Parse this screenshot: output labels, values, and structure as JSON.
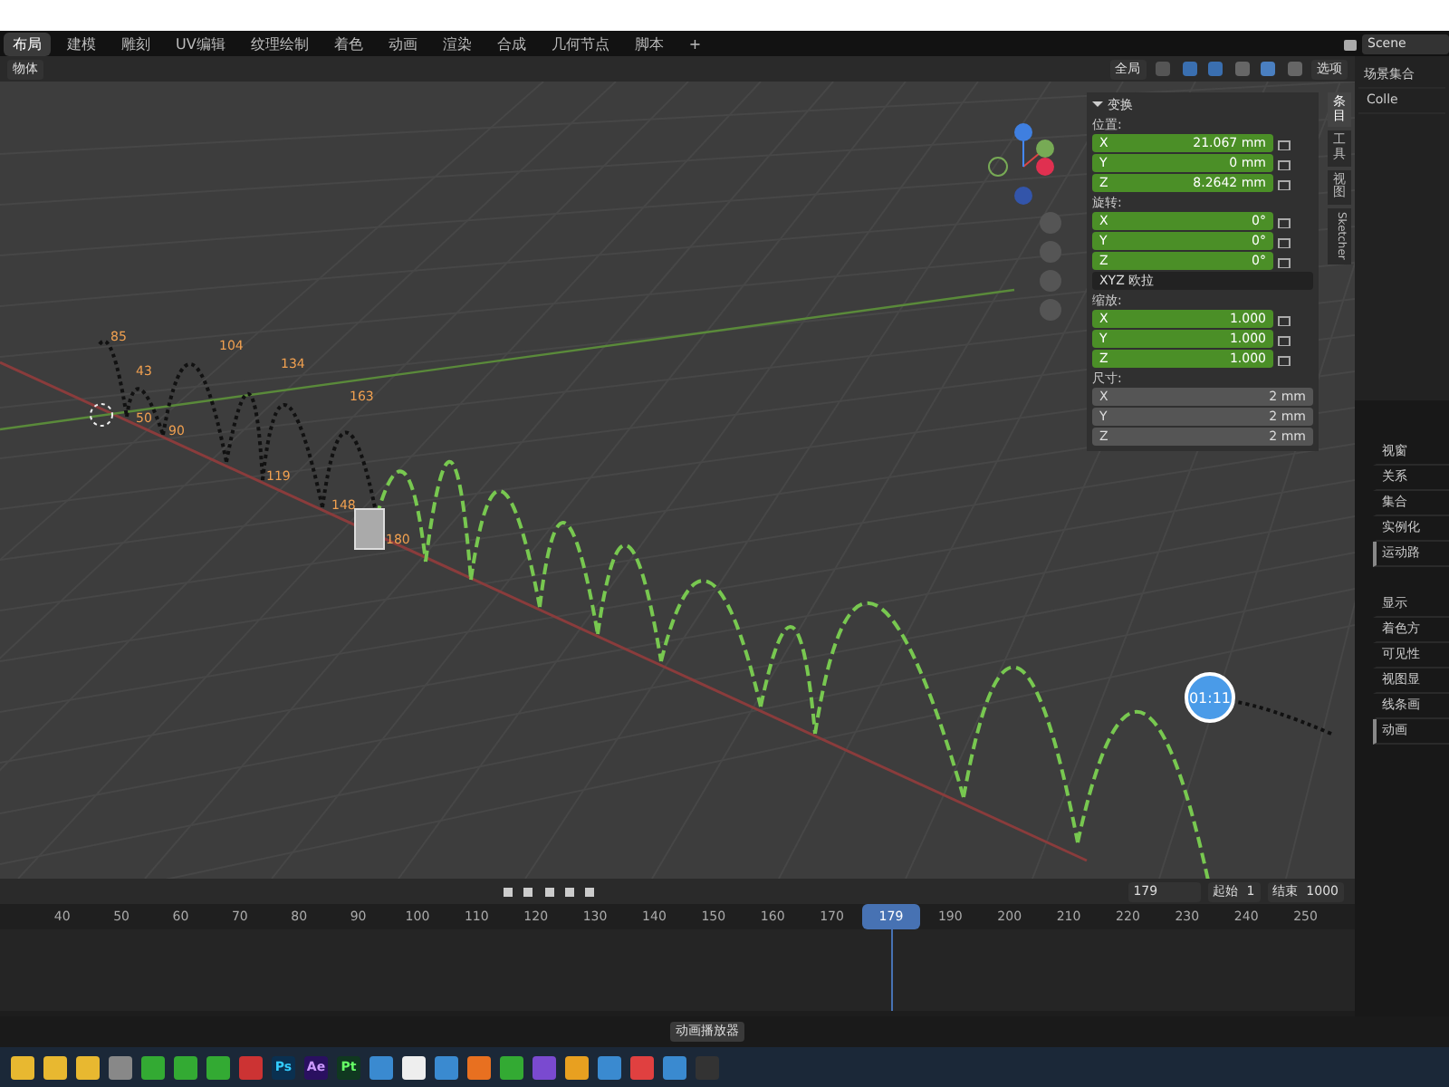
{
  "workspace_tabs": [
    {
      "label": "布局",
      "selected": true
    },
    {
      "label": "建模",
      "selected": false
    },
    {
      "label": "雕刻",
      "selected": false
    },
    {
      "label": "UV编辑",
      "selected": false
    },
    {
      "label": "纹理绘制",
      "selected": false
    },
    {
      "label": "着色",
      "selected": false
    },
    {
      "label": "动画",
      "selected": false
    },
    {
      "label": "渲染",
      "selected": false
    },
    {
      "label": "合成",
      "selected": false
    },
    {
      "label": "几何节点",
      "selected": false
    },
    {
      "label": "脚本",
      "selected": false
    }
  ],
  "add_workspace": "+",
  "scene": {
    "name": "Scene"
  },
  "header": {
    "mode": "物体",
    "orientation": "全局",
    "options": "选项"
  },
  "viewport": {
    "path_labels": [
      "85",
      "43",
      "50",
      "90",
      "104",
      "134",
      "163",
      "119",
      "148",
      "180"
    ],
    "timer": "01:11"
  },
  "sidebar_tabs": [
    {
      "label": "条目",
      "selected": true
    },
    {
      "label": "工具",
      "selected": false
    },
    {
      "label": "视图",
      "selected": false
    },
    {
      "label": "Sketcher",
      "selected": false
    }
  ],
  "transform": {
    "title": "变换",
    "expanded": true,
    "groups": [
      {
        "label": "位置:",
        "animated": true,
        "fields": [
          {
            "axis": "X",
            "value": "21.067 mm"
          },
          {
            "axis": "Y",
            "value": "0 mm"
          },
          {
            "axis": "Z",
            "value": "8.2642 mm"
          }
        ]
      },
      {
        "label": "旋转:",
        "animated": true,
        "fields": [
          {
            "axis": "X",
            "value": "0°"
          },
          {
            "axis": "Y",
            "value": "0°"
          },
          {
            "axis": "Z",
            "value": "0°"
          }
        ]
      },
      {
        "label": "缩放:",
        "animated": true,
        "fields": [
          {
            "axis": "X",
            "value": "1.000"
          },
          {
            "axis": "Y",
            "value": "1.000"
          },
          {
            "axis": "Z",
            "value": "1.000"
          }
        ]
      },
      {
        "label": "尺寸:",
        "animated": false,
        "fields": [
          {
            "axis": "X",
            "value": "2 mm"
          },
          {
            "axis": "Y",
            "value": "2 mm"
          },
          {
            "axis": "Z",
            "value": "2 mm"
          }
        ]
      }
    ],
    "rotation_mode": "XYZ 欧拉"
  },
  "outliner": {
    "root": "场景集合",
    "children": [
      {
        "label": "Colle"
      }
    ]
  },
  "properties": {
    "sections": [
      {
        "label": "视窗",
        "expanded": false
      },
      {
        "label": "关系",
        "expanded": false
      },
      {
        "label": "集合",
        "expanded": false
      },
      {
        "label": "实例化",
        "expanded": false
      },
      {
        "label": "运动路",
        "expanded": true
      },
      {
        "label": "显示",
        "expanded": false
      },
      {
        "label": "着色方",
        "expanded": false
      },
      {
        "label": "可见性",
        "expanded": false
      },
      {
        "label": "视图显",
        "expanded": false
      },
      {
        "label": "线条画",
        "expanded": false
      },
      {
        "label": "动画",
        "expanded": true
      }
    ]
  },
  "timeline": {
    "current_frame": "179",
    "start_label": "起始",
    "start": "1",
    "end_label": "结束",
    "end": "1000",
    "ticks": [
      "40",
      "50",
      "60",
      "70",
      "80",
      "90",
      "100",
      "110",
      "120",
      "130",
      "140",
      "150",
      "160",
      "170",
      "179",
      "190",
      "200",
      "210",
      "220",
      "230",
      "240",
      "250"
    ]
  },
  "tooltip": "动画播放器",
  "taskbar": {
    "apps": [
      "Ps",
      "Ae",
      "Pt"
    ]
  }
}
